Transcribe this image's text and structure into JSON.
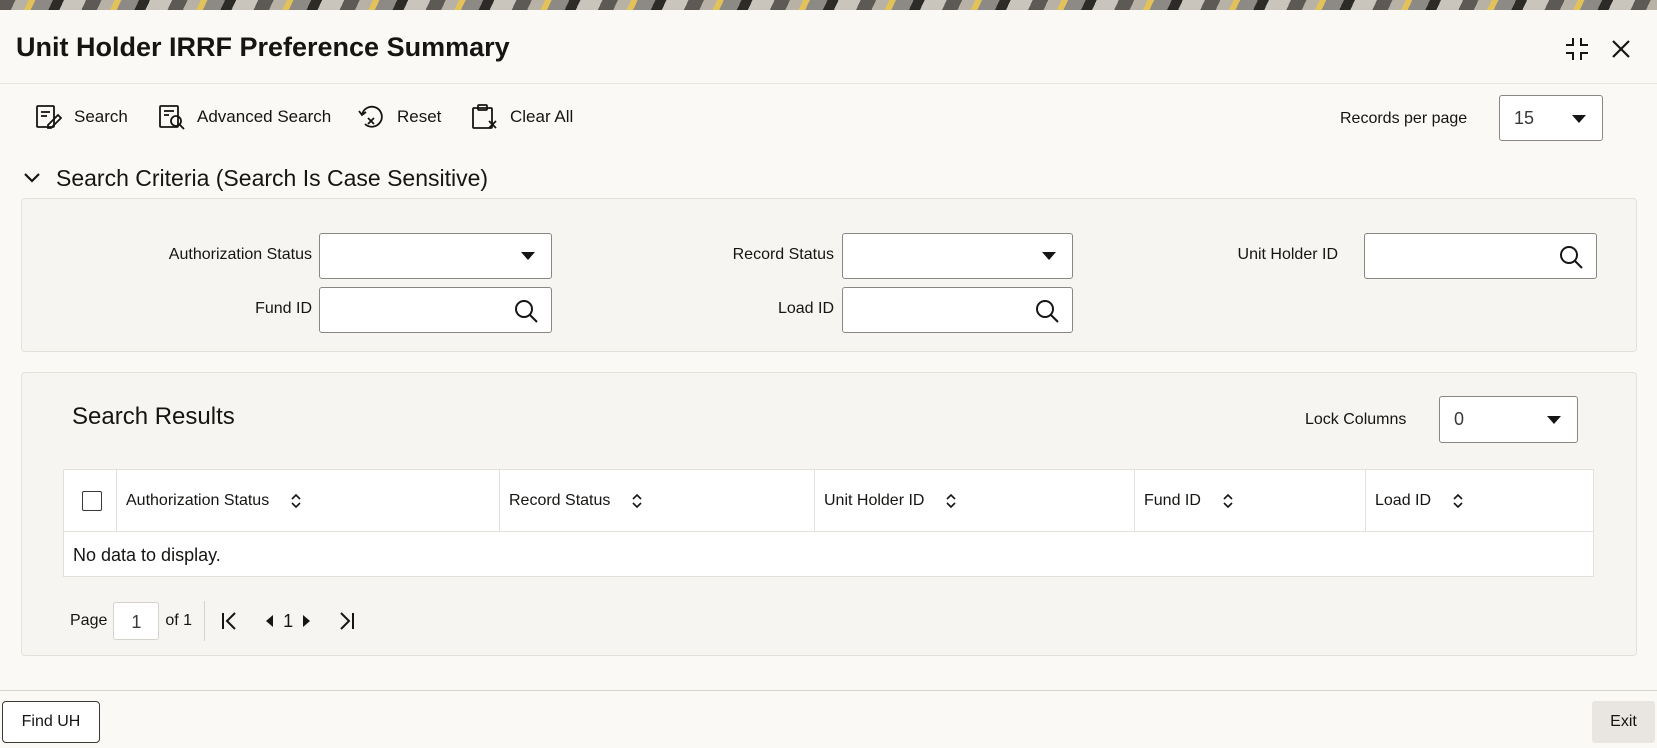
{
  "window": {
    "title": "Unit Holder IRRF Preference Summary",
    "maximize_icon": "maximize-icon",
    "close_icon": "close-icon"
  },
  "toolbar": {
    "search_label": "Search",
    "advanced_search_label": "Advanced Search",
    "reset_label": "Reset",
    "clear_all_label": "Clear All",
    "records_per_page_label": "Records per page",
    "records_per_page_value": "15"
  },
  "criteria": {
    "section_title": "Search Criteria (Search Is Case Sensitive)",
    "fields": {
      "authorization_status": {
        "label": "Authorization Status",
        "value": ""
      },
      "record_status": {
        "label": "Record Status",
        "value": ""
      },
      "unit_holder_id": {
        "label": "Unit Holder ID",
        "value": ""
      },
      "fund_id": {
        "label": "Fund ID",
        "value": ""
      },
      "load_id": {
        "label": "Load ID",
        "value": ""
      }
    }
  },
  "results": {
    "title": "Search Results",
    "lock_columns_label": "Lock Columns",
    "lock_columns_value": "0",
    "columns": [
      "Authorization Status",
      "Record Status",
      "Unit Holder ID",
      "Fund ID",
      "Load ID"
    ],
    "rows": [],
    "empty_text": "No data to display.",
    "pager": {
      "page_label": "Page",
      "current_page": "1",
      "of_label": "of 1",
      "current_page_display": "1"
    }
  },
  "footer": {
    "find_uh_label": "Find UH",
    "exit_label": "Exit"
  },
  "colors": {
    "text": "#161513",
    "border": "#8a8782",
    "panel_bg": "#f7f5f2"
  }
}
